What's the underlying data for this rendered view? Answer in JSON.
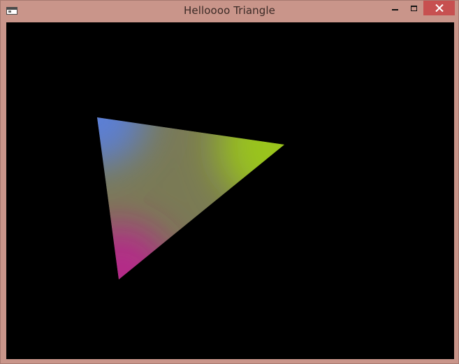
{
  "window": {
    "title": "Helloooo Triangle",
    "frame_color": "#c9958a",
    "close_button_color": "#c75050"
  },
  "titlebar_controls": [
    {
      "name": "minimize-icon"
    },
    {
      "name": "maximize-icon"
    },
    {
      "name": "close-icon"
    }
  ],
  "canvas": {
    "background": "#000000",
    "triangle": {
      "vertex_colors": [
        "#5b7fd6",
        "#9ac41a",
        "#b42c88"
      ]
    }
  }
}
